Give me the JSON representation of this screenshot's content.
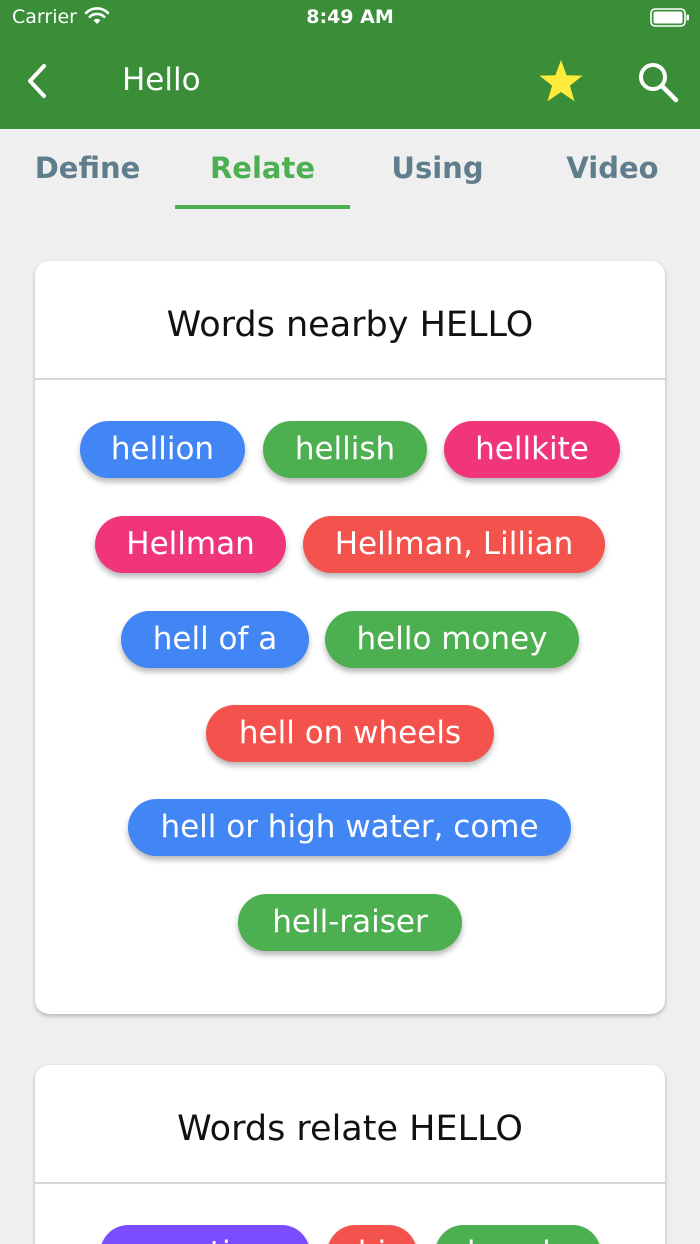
{
  "status_bar": {
    "carrier": "Carrier",
    "time": "8:49 AM"
  },
  "app_bar": {
    "title": "Hello",
    "color": "#3a8e38"
  },
  "tabs": [
    {
      "label": "Define",
      "active": false
    },
    {
      "label": "Relate",
      "active": true
    },
    {
      "label": "Using",
      "active": false
    },
    {
      "label": "Video",
      "active": false
    }
  ],
  "nearby": {
    "title": "Words nearby HELLO",
    "chips": [
      {
        "label": "hellion",
        "color": "#4285f4"
      },
      {
        "label": "hellish",
        "color": "#4caf50"
      },
      {
        "label": "hellkite",
        "color": "#f0357a"
      },
      {
        "label": "Hellman",
        "color": "#f0357a"
      },
      {
        "label": "Hellman, Lillian",
        "color": "#f4524d"
      },
      {
        "label": "hell of a",
        "color": "#4285f4"
      },
      {
        "label": "hello money",
        "color": "#4caf50"
      },
      {
        "label": "hell on wheels",
        "color": "#f4524d"
      },
      {
        "label": "hell or high water, come",
        "color": "#4285f4"
      },
      {
        "label": "hell-raiser",
        "color": "#4caf50"
      }
    ]
  },
  "related": {
    "title": "Words relate HELLO",
    "chips": [
      {
        "label": "greeting",
        "color": "#7c4dff"
      },
      {
        "label": "hi",
        "color": "#f4524d"
      },
      {
        "label": "howdy",
        "color": "#4caf50"
      }
    ]
  },
  "colors": {
    "tab_active": "#4caf50",
    "tab_inactive": "#607d8b",
    "star": "#ffeb3b"
  }
}
